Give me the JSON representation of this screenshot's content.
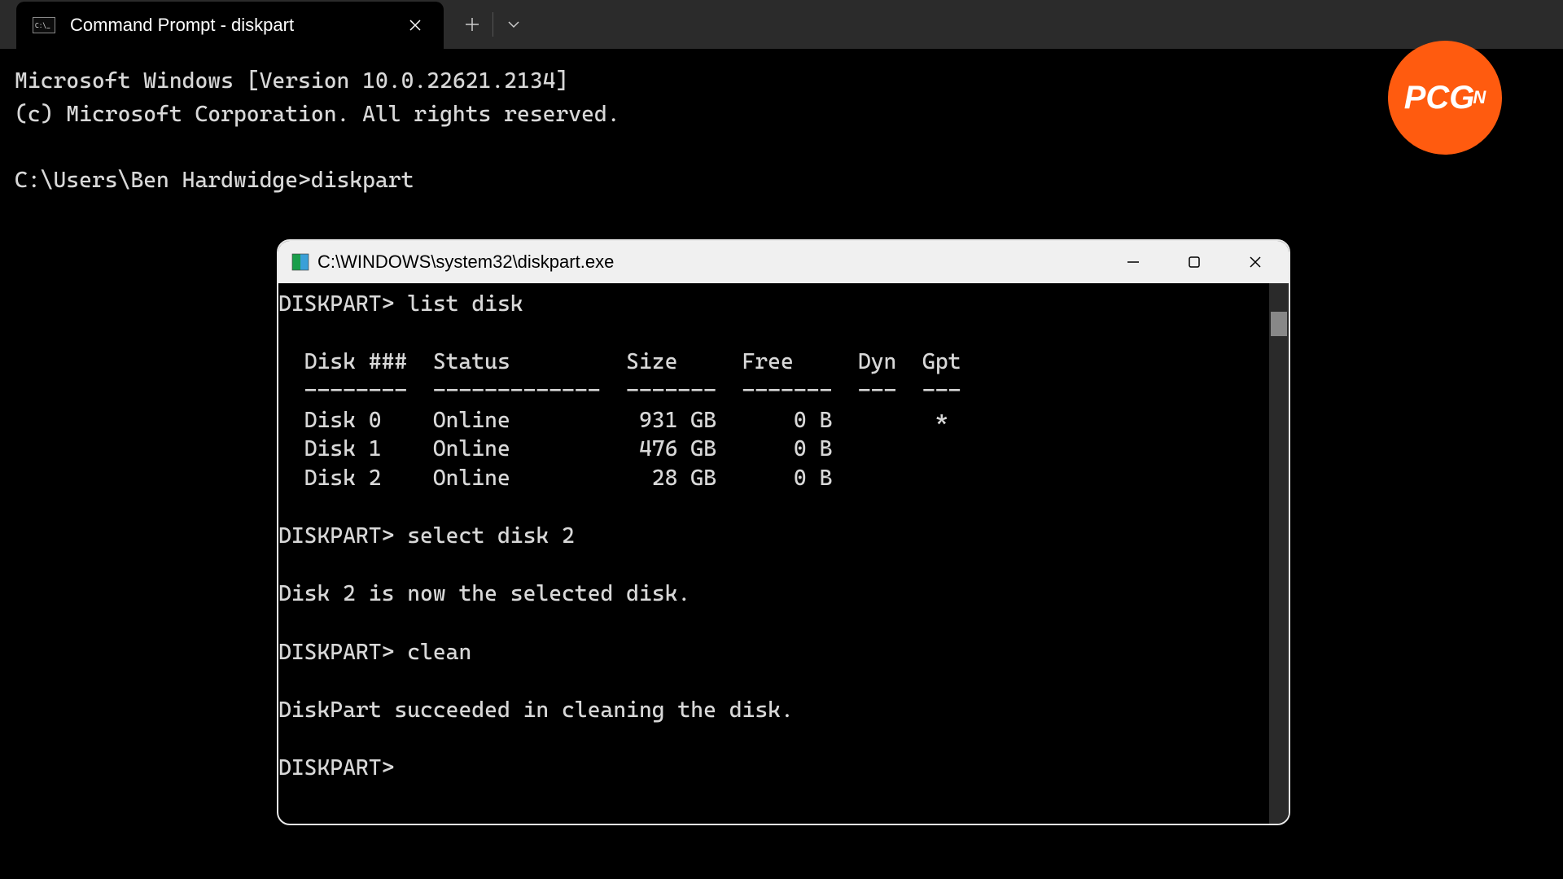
{
  "titlebar": {
    "tab_title": "Command Prompt - diskpart"
  },
  "main_terminal": {
    "line1": "Microsoft Windows [Version 10.0.22621.2134]",
    "line2": "(c) Microsoft Corporation. All rights reserved.",
    "prompt": "C:\\Users\\Ben Hardwidge>",
    "command": "diskpart"
  },
  "child_window": {
    "title": "C:\\WINDOWS\\system32\\diskpart.exe",
    "diskpart": {
      "prompt": "DISKPART>",
      "cmd_list": "list disk",
      "header": "  Disk ###  Status         Size     Free     Dyn  Gpt",
      "separator": "  --------  -------------  -------  -------  ---  ---",
      "rows": [
        "  Disk 0    Online          931 GB      0 B        *",
        "  Disk 1    Online          476 GB      0 B",
        "  Disk 2    Online           28 GB      0 B"
      ],
      "cmd_select": "select disk 2",
      "msg_select": "Disk 2 is now the selected disk.",
      "cmd_clean": "clean",
      "msg_clean": "DiskPart succeeded in cleaning the disk."
    }
  },
  "badge": {
    "text_main": "PCG",
    "text_sup": "N"
  },
  "disk_table_data": [
    {
      "disk": "Disk 0",
      "status": "Online",
      "size": "931 GB",
      "free": "0 B",
      "dyn": "",
      "gpt": "*"
    },
    {
      "disk": "Disk 1",
      "status": "Online",
      "size": "476 GB",
      "free": "0 B",
      "dyn": "",
      "gpt": ""
    },
    {
      "disk": "Disk 2",
      "status": "Online",
      "size": "28 GB",
      "free": "0 B",
      "dyn": "",
      "gpt": ""
    }
  ]
}
